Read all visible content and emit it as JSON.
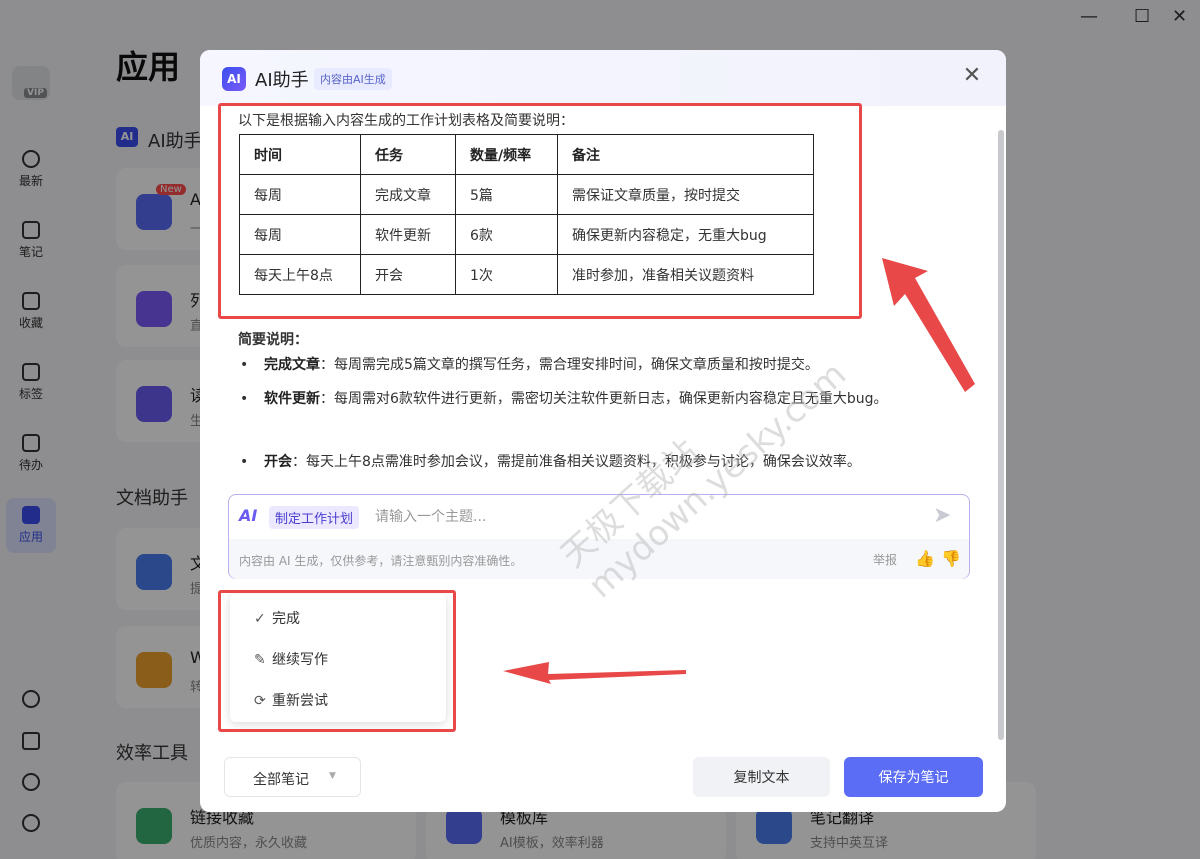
{
  "window": {
    "minimize": "—",
    "maximize": "☐",
    "close": "✕"
  },
  "sidebar": {
    "vip": "VIP",
    "items": [
      {
        "label": "最新",
        "icon": "clock-icon"
      },
      {
        "label": "笔记",
        "icon": "note-icon"
      },
      {
        "label": "收藏",
        "icon": "link-icon"
      },
      {
        "label": "标签",
        "icon": "tag-icon"
      },
      {
        "label": "待办",
        "icon": "checkbox-icon"
      },
      {
        "label": "应用",
        "icon": "apps-icon",
        "active": true
      }
    ],
    "bottom_icons": [
      "link-icon",
      "trash-icon",
      "sync-icon",
      "settings-icon"
    ]
  },
  "background": {
    "page_title": "应用",
    "section_ai": "AI助手",
    "section_doc": "文档助手",
    "section_eff": "效率工具",
    "card_letters": [
      "A",
      "列",
      "读",
      "文",
      "W"
    ],
    "card_subs": [
      "一",
      "直",
      "生",
      "提",
      "转"
    ],
    "new_tag": "New",
    "bottom_cards": [
      {
        "title": "链接收藏",
        "sub": "优质内容，永久收藏"
      },
      {
        "title": "模板库",
        "sub": "AI模板，效率利器"
      },
      {
        "title": "笔记翻译",
        "sub": "支持中英互译"
      }
    ]
  },
  "dialog": {
    "logo": "AI",
    "title": "AI助手",
    "tag": "内容由AI生成",
    "intro": "以下是根据输入内容生成的工作计划表格及简要说明：",
    "table": {
      "headers": [
        "时间",
        "任务",
        "数量/频率",
        "备注"
      ],
      "rows": [
        [
          "每周",
          "完成文章",
          "5篇",
          "需保证文章质量，按时提交"
        ],
        [
          "每周",
          "软件更新",
          "6款",
          "确保更新内容稳定，无重大bug"
        ],
        [
          "每天上午8点",
          "开会",
          "1次",
          "准时参加，准备相关议题资料"
        ]
      ]
    },
    "summary_title": "简要说明：",
    "bullets": [
      {
        "bold": "完成文章",
        "text": "：每周需完成5篇文章的撰写任务，需合理安排时间，确保文章质量和按时提交。"
      },
      {
        "bold": "软件更新",
        "text": "：每周需对6款软件进行更新，需密切关注软件更新日志，确保更新内容稳定且无重大bug。"
      },
      {
        "bold": "开会",
        "text": "：每天上午8点需准时参加会议，需提前准备相关议题资料，积极参与讨论，确保会议效率。"
      }
    ],
    "input": {
      "logo": "AI",
      "chip": "制定工作计划",
      "placeholder": "请输入一个主题...",
      "disclaimer": "内容由 AI 生成，仅供参考，请注意甄别内容准确性。",
      "report": "举报"
    },
    "menu": [
      {
        "icon": "✓",
        "label": "完成"
      },
      {
        "icon": "✎",
        "label": "继续写作"
      },
      {
        "icon": "⟳",
        "label": "重新尝试"
      }
    ],
    "dropdown": "全部笔记",
    "copy_button": "复制文本",
    "save_button": "保存为笔记"
  },
  "watermark": {
    "cn": "天极下载站",
    "url": "mydown.yesky.com"
  },
  "colors": {
    "accent": "#5b6cf5",
    "annotation": "#e84848"
  }
}
